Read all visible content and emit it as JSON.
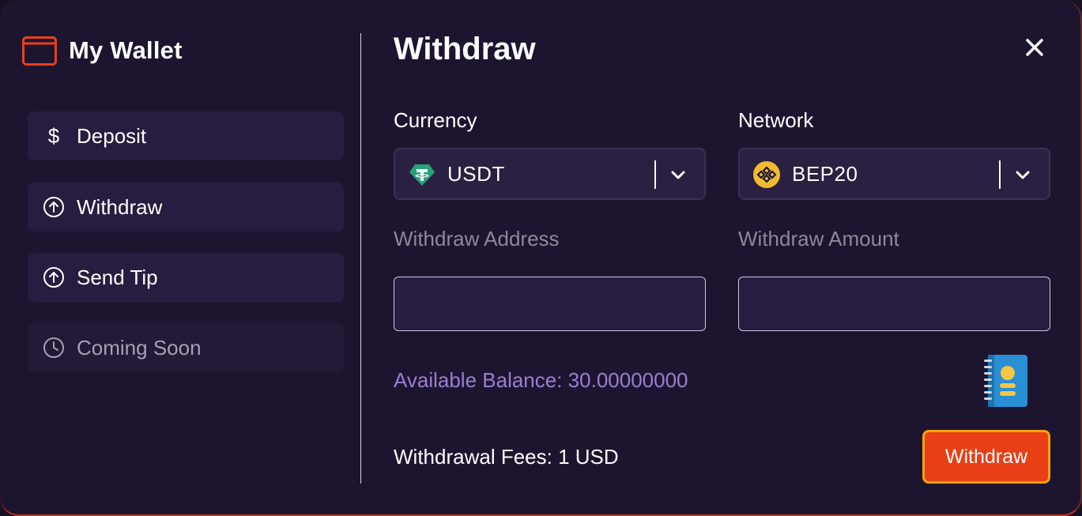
{
  "sidebar": {
    "title": "My Wallet",
    "items": [
      {
        "label": "Deposit",
        "icon": "dollar-icon",
        "symbol": "$"
      },
      {
        "label": "Withdraw",
        "icon": "arrow-up-circle-icon"
      },
      {
        "label": "Send Tip",
        "icon": "arrow-up-circle-icon"
      },
      {
        "label": "Coming Soon",
        "icon": "clock-icon"
      }
    ]
  },
  "main": {
    "title": "Withdraw",
    "currency": {
      "label": "Currency",
      "value": "USDT",
      "icon": "tether-icon"
    },
    "network": {
      "label": "Network",
      "value": "BEP20",
      "icon": "bnb-icon"
    },
    "address": {
      "label": "Withdraw Address",
      "value": ""
    },
    "amount": {
      "label": "Withdraw Amount",
      "value": ""
    },
    "available_balance": "Available Balance: 30.00000000",
    "fees": "Withdrawal Fees: 1 USD",
    "submit_label": "Withdraw"
  },
  "colors": {
    "background": "#1d1530",
    "panel": "#271d40",
    "accent": "#e83f17",
    "accent_border": "#f4a20c",
    "balance_text": "#9a7fd1",
    "muted_text": "#8e879c"
  }
}
